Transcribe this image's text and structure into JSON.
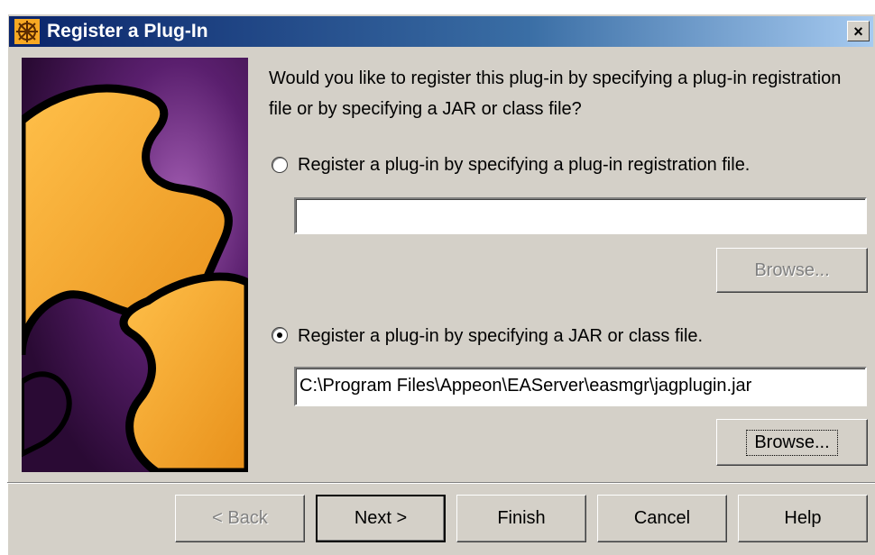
{
  "window": {
    "title": "Register a Plug-In",
    "close_label": "×"
  },
  "main": {
    "question": "Would you like to register this plug-in by specifying a plug-in registration file or by specifying a JAR or class file?",
    "option1": {
      "label": "Register a plug-in by specifying a plug-in registration file.",
      "selected": false,
      "input_value": "",
      "browse_label": "Browse...",
      "browse_enabled": false
    },
    "option2": {
      "label": "Register a plug-in by specifying a JAR or class file.",
      "selected": true,
      "input_value": "C:\\Program Files\\Appeon\\EAServer\\easmgr\\jagplugin.jar",
      "browse_label": "Browse...",
      "browse_enabled": true
    }
  },
  "footer": {
    "back_label": "< Back",
    "next_label": "Next >",
    "finish_label": "Finish",
    "cancel_label": "Cancel",
    "help_label": "Help"
  },
  "colors": {
    "dialog_bg": "#d4d0c8",
    "title_gradient_start": "#0a246a",
    "title_gradient_end": "#a6caf0",
    "puzzle_orange": "#f7a823",
    "puzzle_bg_purple": "#4a1a5c"
  }
}
